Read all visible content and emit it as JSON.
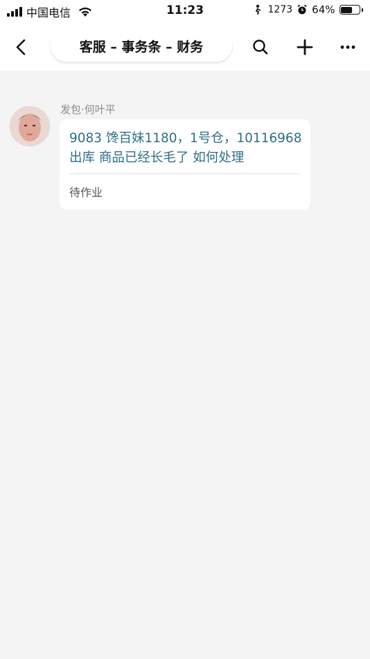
{
  "status_bar": {
    "carrier": "中国电信",
    "time": "11:23",
    "steps": "1273",
    "battery_percent": "64%",
    "battery_level": 0.64
  },
  "nav": {
    "title": "客服 – 事务条 – 财务",
    "back_icon": "chevron-left-icon",
    "search_icon": "search-icon",
    "add_icon": "plus-icon",
    "more_icon": "more-dots-icon"
  },
  "message": {
    "sender": "发包·何叶平",
    "text_line1": "9083 馋百妹1180，1号仓，10116968",
    "text_line2": "出库 商品已经长毛了 如何处理",
    "status": "待作业",
    "text_color": "#2f6f86"
  }
}
